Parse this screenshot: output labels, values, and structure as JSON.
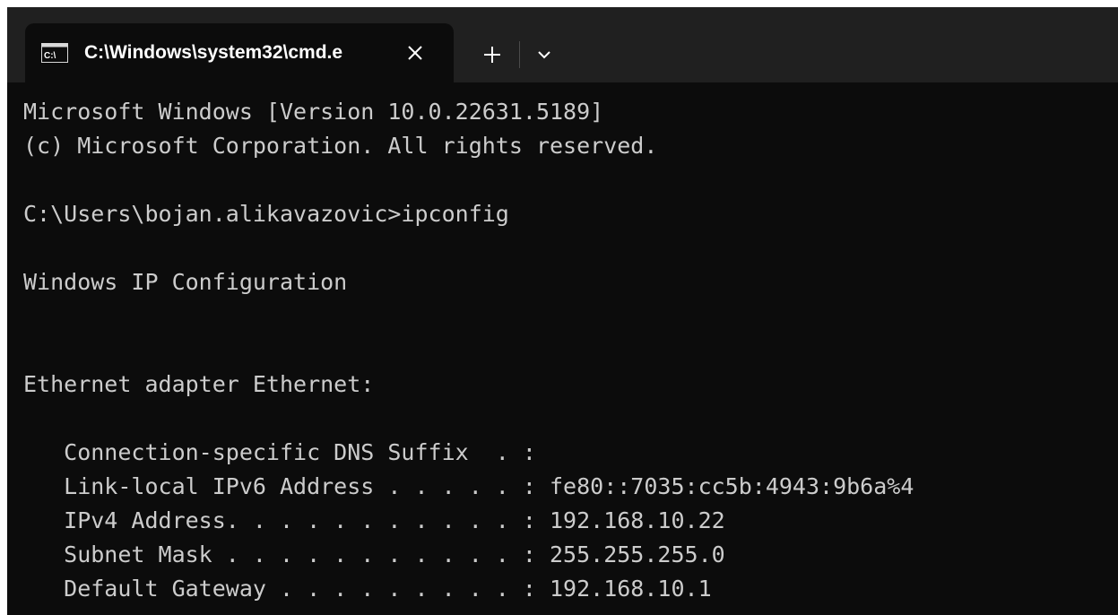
{
  "tab": {
    "title": "C:\\Windows\\system32\\cmd.e",
    "icon": "cmd-icon",
    "icon_text": "C:\\"
  },
  "tabbar": {
    "new_tab": "+",
    "dropdown": "chevron-down-icon",
    "close": "close-icon"
  },
  "terminal": {
    "lines": [
      "Microsoft Windows [Version 10.0.22631.5189]",
      "(c) Microsoft Corporation. All rights reserved.",
      "",
      "C:\\Users\\bojan.alikavazovic>ipconfig",
      "",
      "Windows IP Configuration",
      "",
      "",
      "Ethernet adapter Ethernet:",
      "",
      "   Connection-specific DNS Suffix  . :",
      "   Link-local IPv6 Address . . . . . : fe80::7035:cc5b:4943:9b6a%4",
      "   IPv4 Address. . . . . . . . . . . : 192.168.10.22",
      "   Subnet Mask . . . . . . . . . . . : 255.255.255.0",
      "   Default Gateway . . . . . . . . . : 192.168.10.1"
    ]
  },
  "colors": {
    "terminal_bg": "#0c0c0c",
    "tabbar_bg": "#202020",
    "text": "#cccccc",
    "tab_text": "#ffffff"
  }
}
